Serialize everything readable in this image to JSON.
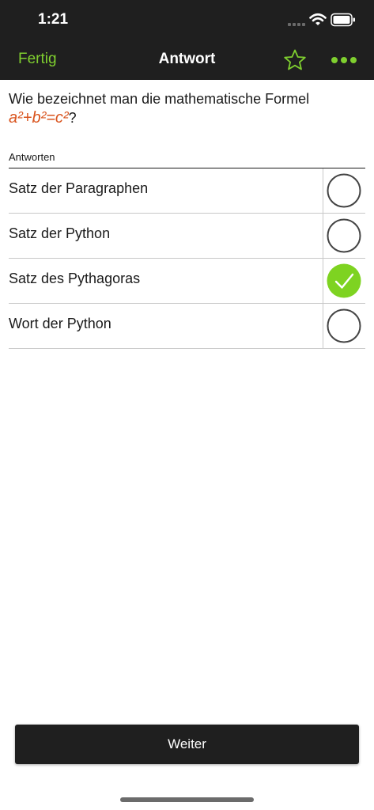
{
  "status_bar": {
    "time": "1:21",
    "icons": [
      "signal-icon",
      "wifi-icon",
      "battery-icon"
    ]
  },
  "nav": {
    "done_label": "Fertig",
    "title": "Antwort",
    "star_icon": "star-outline-icon",
    "more_icon": "more-dots-icon"
  },
  "question": {
    "text": "Wie bezeichnet man die mathematische Formel",
    "formula": "a²+b²=c²",
    "suffix": "?"
  },
  "answers": {
    "section_label": "Antworten",
    "items": [
      {
        "label": "Satz der Paragraphen",
        "selected": false
      },
      {
        "label": "Satz der Python",
        "selected": false
      },
      {
        "label": "Satz des Pythagoras",
        "selected": true
      },
      {
        "label": "Wort der Python",
        "selected": false
      }
    ]
  },
  "footer": {
    "next_label": "Weiter"
  },
  "colors": {
    "accent_green": "#7fcf2f",
    "check_green": "#7ed321",
    "formula_orange": "#d9541e",
    "bar_background": "#1f1f1f"
  }
}
